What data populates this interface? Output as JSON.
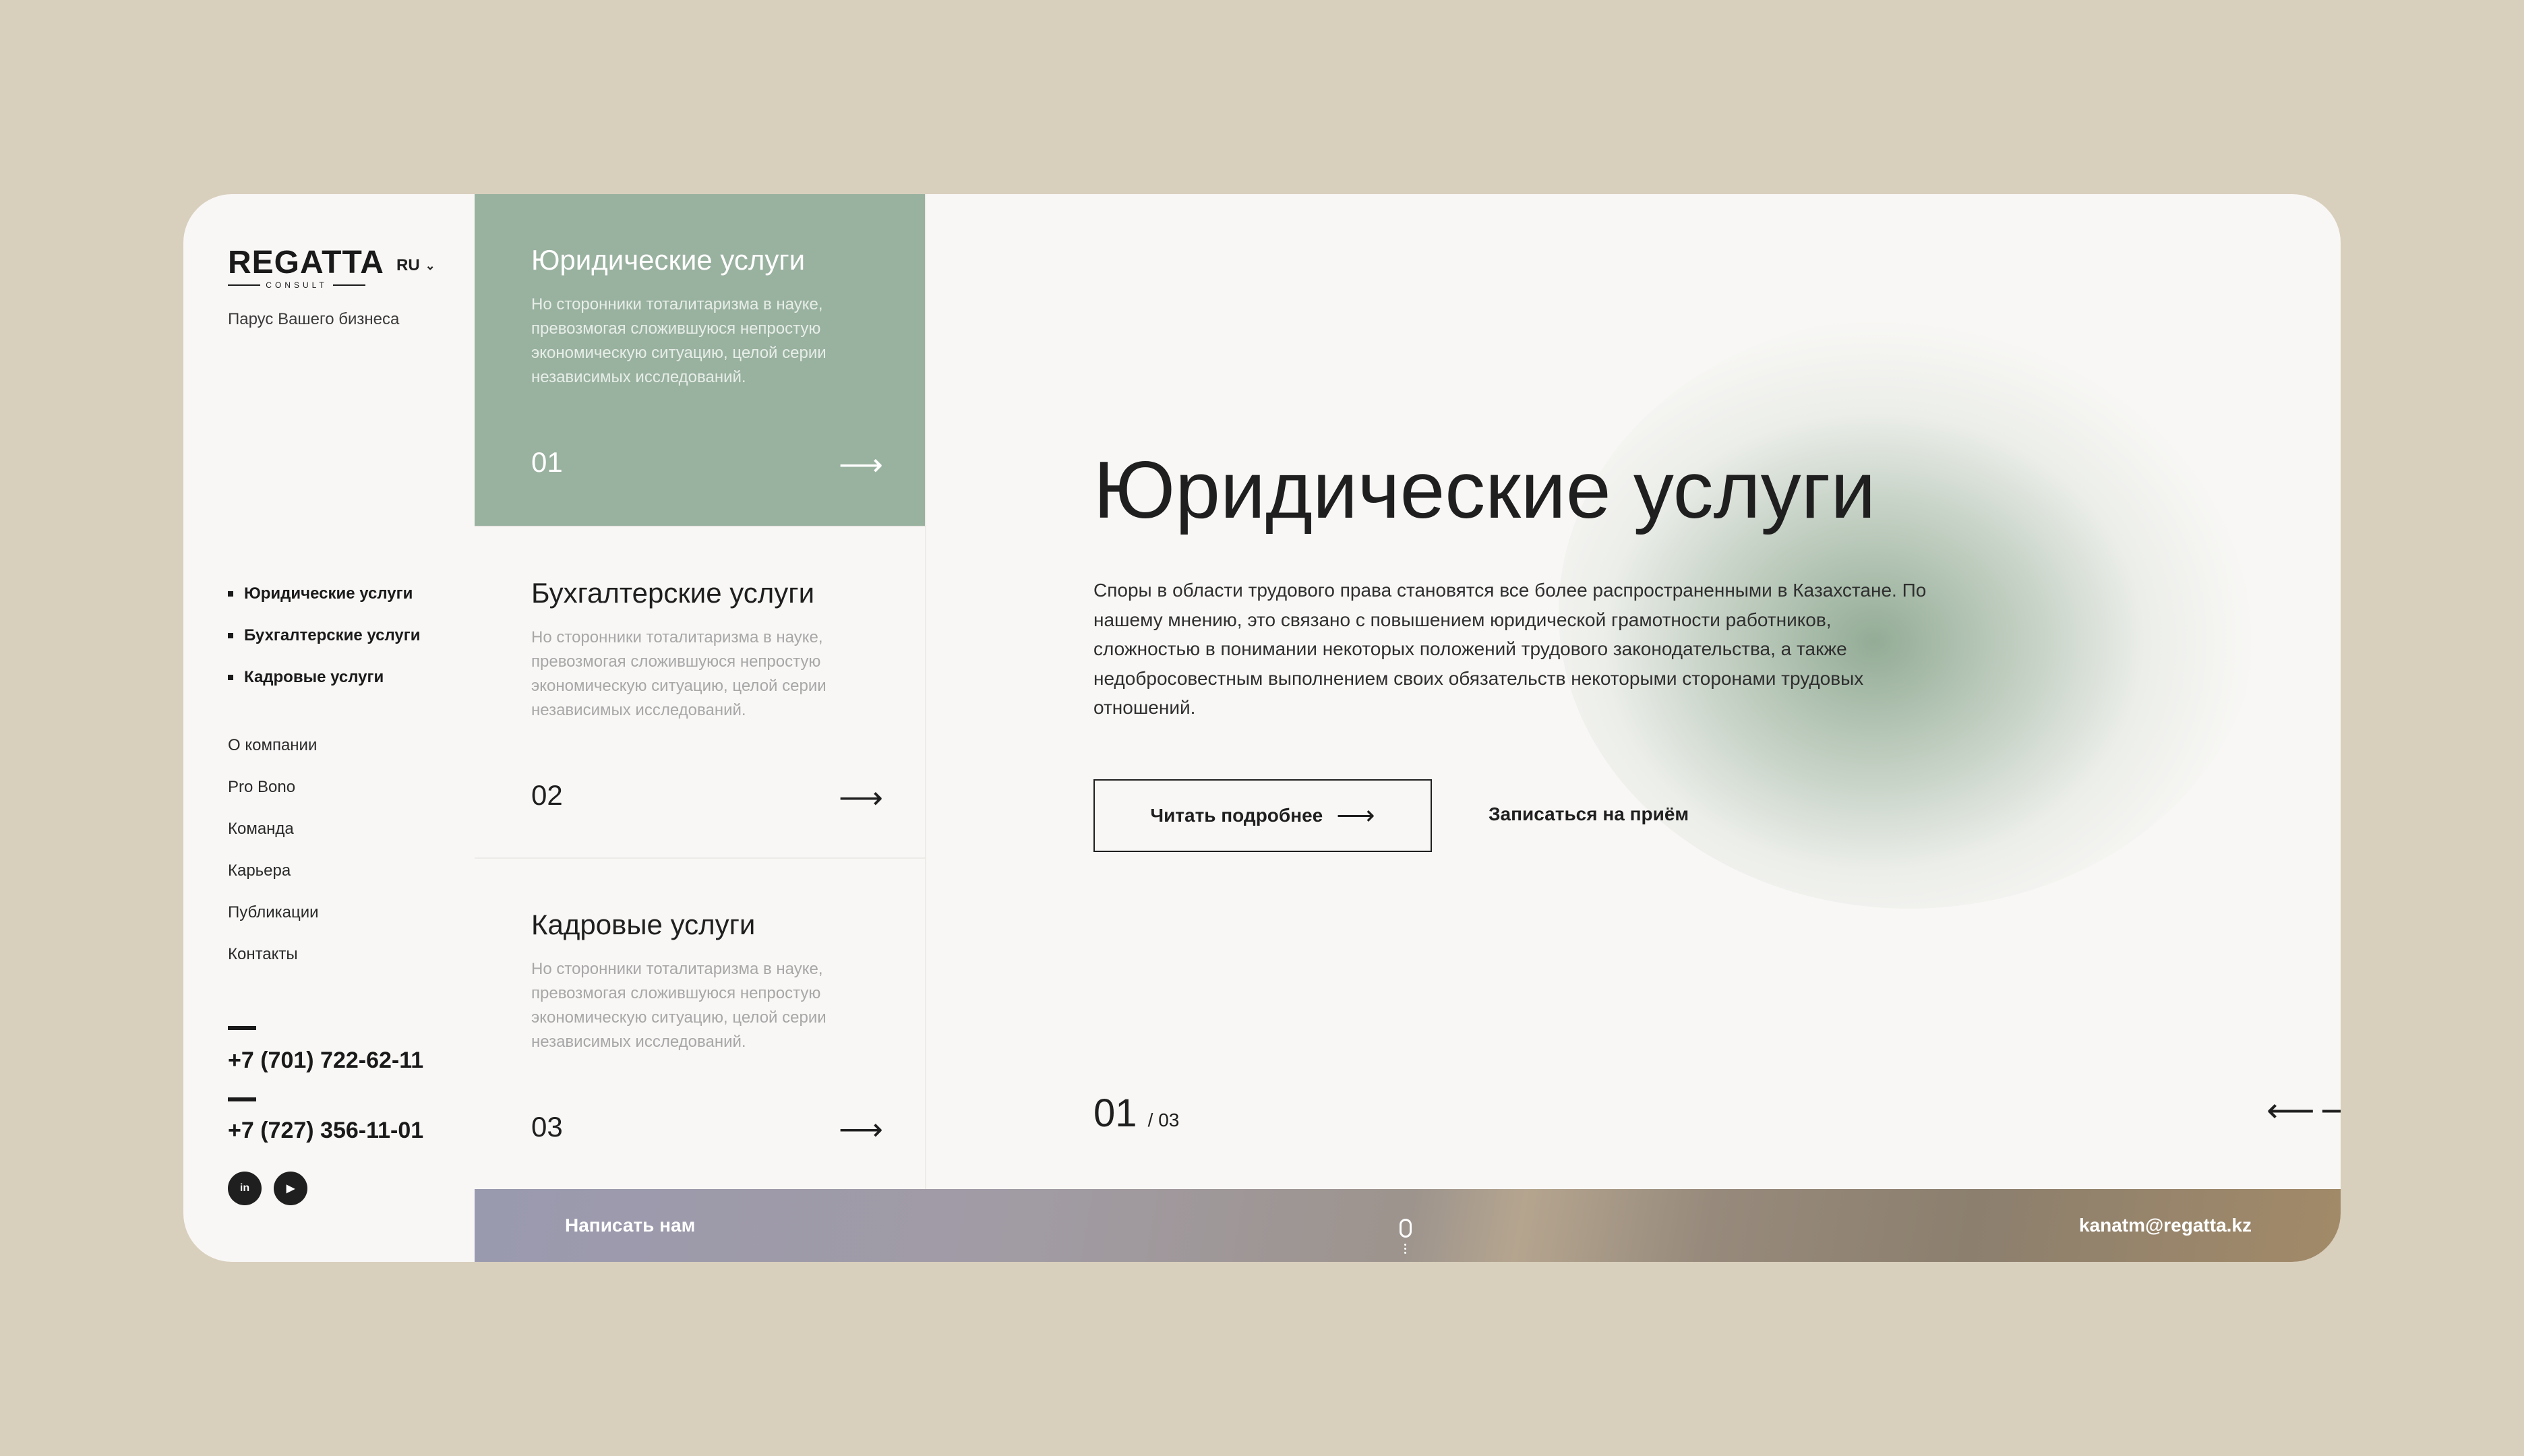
{
  "brand": {
    "logo_main": "REGATTA",
    "logo_sub": "CONSULT",
    "tagline": "Парус Вашего бизнеса",
    "language": "RU"
  },
  "sidebar": {
    "services": [
      "Юридические услуги",
      "Бухгалтерские услуги",
      "Кадровые услуги"
    ],
    "nav": [
      "О компании",
      "Pro Bono",
      "Команда",
      "Карьера",
      "Публикации",
      "Контакты"
    ],
    "phones": [
      "+7 (701) 722-62-11",
      "+7 (727) 356-11-01"
    ],
    "social": [
      {
        "label": "in",
        "icon": "linkedin-icon"
      },
      {
        "label": "▶",
        "icon": "youtube-icon"
      }
    ]
  },
  "cards": [
    {
      "title": "Юридические услуги",
      "desc": "Но сторонники тоталитаризма в науке, превозмогая сложившуюся непростую экономическую ситуацию, целой серии независимых исследований.",
      "num": "01",
      "arrow": "⟶",
      "active": true
    },
    {
      "title": "Бухгалтерские услуги",
      "desc": "Но сторонники тоталитаризма в науке, превозмогая сложившуюся непростую экономическую ситуацию, целой серии независимых исследований.",
      "num": "02",
      "arrow": "⟶",
      "active": false
    },
    {
      "title": "Кадровые услуги",
      "desc": "Но сторонники тоталитаризма в науке, превозмогая сложившуюся непростую экономическую ситуацию, целой серии независимых исследований.",
      "num": "03",
      "arrow": "⟶",
      "active": false
    }
  ],
  "hero": {
    "title": "Юридические услуги",
    "text": "Споры в области трудового права становятся все более распространенными в Казахстане. По нашему мнению, это связано с повышением юридической грамотности работников, сложностью в понимании некоторых положений трудового законодательства, а также недобросовестным выполнением своих обязательств некоторыми сторонами трудовых отношений.",
    "btn_more": "Читать подробнее",
    "btn_more_arrow": "⟶",
    "btn_book": "Записаться на приём",
    "counter_current": "01",
    "counter_total": "/ 03",
    "prev_arrow": "⟵",
    "next_arrow": "⟶"
  },
  "footer": {
    "write_us": "Написать нам",
    "email": "kanatm@regatta.kz"
  },
  "colors": {
    "background": "#d9cfbd",
    "card": "#f8f7f5",
    "active_card": "#99b19f",
    "text": "#1f1f1f",
    "muted": "#a7a7a7"
  }
}
